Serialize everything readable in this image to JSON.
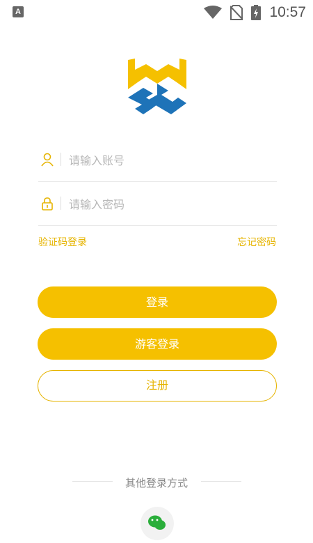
{
  "statusbar": {
    "time": "10:57",
    "app_icon": "A"
  },
  "login": {
    "account_placeholder": "请输入账号",
    "password_placeholder": "请输入密码",
    "sms_login_link": "验证码登录",
    "forgot_password_link": "忘记密码",
    "login_button": "登录",
    "guest_login_button": "游客登录",
    "register_button": "注册"
  },
  "other": {
    "label": "其他登录方式"
  },
  "icons": {
    "account": "user-icon",
    "password": "lock-icon",
    "wechat": "wechat-icon"
  },
  "colors": {
    "accent": "#F5C000",
    "logo_blue": "#1E73B8",
    "logo_yellow": "#F5C000"
  }
}
